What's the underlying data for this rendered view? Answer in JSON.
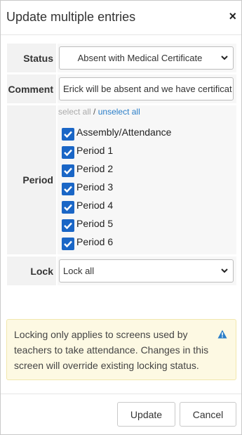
{
  "dialog": {
    "title": "Update multiple entries",
    "close_glyph": "×"
  },
  "status": {
    "label": "Status",
    "selected": "Absent with Medical Certificate"
  },
  "comment": {
    "label": "Comment",
    "value": "Erick will be absent and we have certificat"
  },
  "period": {
    "label": "Period",
    "select_all": "select all",
    "separator": "/",
    "unselect_all": "unselect all",
    "items": [
      {
        "label": "Assembly/Attendance",
        "checked": true
      },
      {
        "label": "Period 1",
        "checked": true
      },
      {
        "label": "Period 2",
        "checked": true
      },
      {
        "label": "Period 3",
        "checked": true
      },
      {
        "label": "Period 4",
        "checked": true
      },
      {
        "label": "Period 5",
        "checked": true
      },
      {
        "label": "Period 6",
        "checked": true
      }
    ]
  },
  "lock": {
    "label": "Lock",
    "selected": "Lock all"
  },
  "alert": {
    "text": "Locking only applies to screens used by teachers to take attendance. Changes in this screen will override existing locking status.",
    "icon": "warning-icon",
    "icon_color": "#2a7ec8"
  },
  "buttons": {
    "update": "Update",
    "cancel": "Cancel"
  },
  "colors": {
    "checkbox": "#1a66c6",
    "link": "#2a7ec8"
  }
}
